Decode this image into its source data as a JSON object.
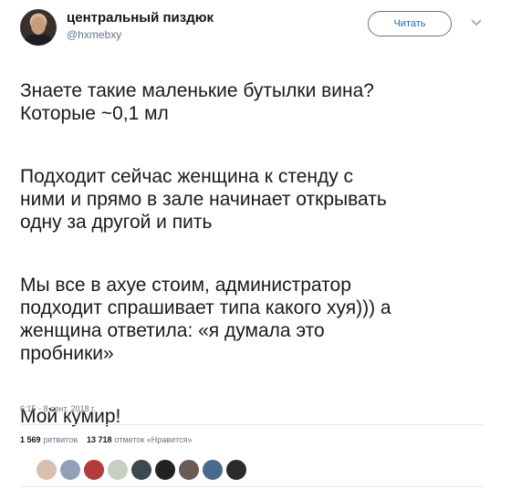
{
  "tweet": {
    "author_name": "центральный пиздюк",
    "author_handle": "@hxmebxy",
    "follow_label": "Читать",
    "paragraphs": [
      "Знаете такие маленькие бутылки вина?\nКоторые ~0,1 мл",
      "Подходит сейчас женщина к стенду с\nними и прямо в зале начинает открывать\nодну за другой и пить",
      "Мы все в ахуе стоим, администратор\nподходит спрашивает типа какого хуя))) а\nженщина ответила: «я думала это\nпробники»",
      "Мой кумир!"
    ],
    "timestamp": "6:15 - 8 сент. 2018 г.",
    "retweet_count": "1 569",
    "retweet_label": "ретвитов",
    "like_count": "13 718",
    "like_label": "отметок «Нравится»"
  },
  "icons": {
    "chevron": "chevron-down-icon",
    "avatar": "author-avatar"
  },
  "colors": {
    "text": "#14171a",
    "muted": "#657786",
    "link": "#1c6ea4",
    "divider": "#e6ecf0"
  },
  "likers": [
    {
      "name": "liker-avatar-1",
      "color": "#d7c0b0"
    },
    {
      "name": "liker-avatar-2",
      "color": "#8fa0b8"
    },
    {
      "name": "liker-avatar-3",
      "color": "#b23a3a"
    },
    {
      "name": "liker-avatar-4",
      "color": "#c8cfc2"
    },
    {
      "name": "liker-avatar-5",
      "color": "#3b4a4e"
    },
    {
      "name": "liker-avatar-6",
      "color": "#222222"
    },
    {
      "name": "liker-avatar-7",
      "color": "#6b5a55"
    },
    {
      "name": "liker-avatar-8",
      "color": "#4a6a8a"
    },
    {
      "name": "liker-avatar-9",
      "color": "#2b2b2b"
    }
  ]
}
